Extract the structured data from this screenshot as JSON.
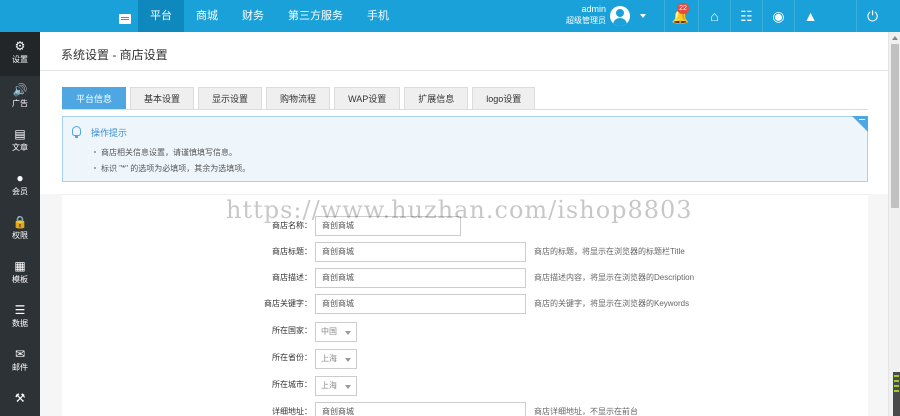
{
  "topnav": {
    "items": [
      {
        "label": "平台",
        "active": true
      },
      {
        "label": "商城",
        "active": false
      },
      {
        "label": "财务",
        "active": false
      },
      {
        "label": "第三方服务",
        "active": false
      },
      {
        "label": "手机",
        "active": false
      }
    ]
  },
  "user": {
    "name": "admin",
    "role": "超级管理员"
  },
  "notifications": {
    "count": "22"
  },
  "sidebar": {
    "items": [
      {
        "label": "设置",
        "icon": "gear-icon",
        "active": true
      },
      {
        "label": "广告",
        "icon": "megaphone-icon"
      },
      {
        "label": "文章",
        "icon": "document-icon"
      },
      {
        "label": "会员",
        "icon": "user-icon"
      },
      {
        "label": "权限",
        "icon": "lock-icon"
      },
      {
        "label": "模板",
        "icon": "template-icon"
      },
      {
        "label": "数据",
        "icon": "database-icon"
      },
      {
        "label": "邮件",
        "icon": "mail-icon"
      }
    ]
  },
  "page": {
    "title": "系统设置 - 商店设置"
  },
  "tabs": [
    {
      "label": "平台信息",
      "active": true
    },
    {
      "label": "基本设置"
    },
    {
      "label": "显示设置"
    },
    {
      "label": "购物流程"
    },
    {
      "label": "WAP设置"
    },
    {
      "label": "扩展信息"
    },
    {
      "label": "logo设置"
    }
  ],
  "tips": {
    "title": "操作提示",
    "lines": [
      "商店相关信息设置，请谨慎填写信息。",
      "标识 \"*\" 的选项为必填项，其余为选填项。"
    ]
  },
  "form": {
    "shop_name": {
      "label": "商店名称：",
      "value": "商创商城"
    },
    "shop_title": {
      "label": "商店标题：",
      "value": "商创商城",
      "hint": "商店的标题，将显示在浏览器的标题栏Title"
    },
    "shop_desc": {
      "label": "商店描述：",
      "value": "商创商城",
      "hint": "商店描述内容，将显示在浏览器的Description"
    },
    "shop_keywords": {
      "label": "商店关键字：",
      "value": "商创商城",
      "hint": "商店的关键字，将显示在浏览器的Keywords"
    },
    "country": {
      "label": "所在国家：",
      "value": "中国"
    },
    "province": {
      "label": "所在省份：",
      "value": "上海"
    },
    "city": {
      "label": "所在城市：",
      "value": "上海"
    },
    "address": {
      "label": "详细地址：",
      "value": "商创商城",
      "hint": "商店详细地址，不显示在前台"
    }
  },
  "watermark": "https://www.huzhan.com/ishop8803",
  "colors": {
    "topbar": "#1aa1d9",
    "sidebar": "#2d3237",
    "accent": "#4ea7e3"
  }
}
